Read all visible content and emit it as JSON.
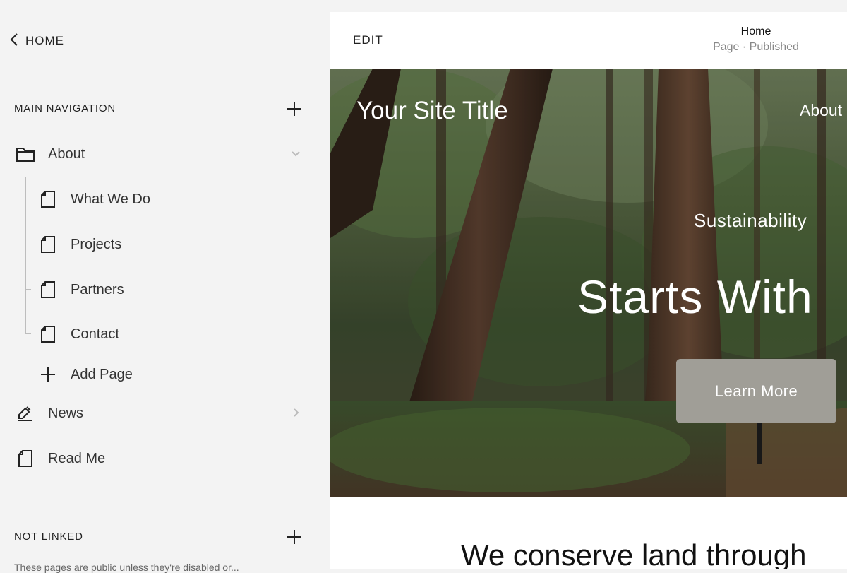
{
  "sidebar": {
    "back_label": "HOME",
    "main_nav_title": "MAIN NAVIGATION",
    "items": [
      {
        "label": "About",
        "icon": "folder-icon"
      },
      {
        "label": "What We Do",
        "icon": "page-icon"
      },
      {
        "label": "Projects",
        "icon": "page-icon"
      },
      {
        "label": "Partners",
        "icon": "page-icon"
      },
      {
        "label": "Contact",
        "icon": "page-icon"
      },
      {
        "label": "Add Page",
        "icon": "plus-icon"
      },
      {
        "label": "News",
        "icon": "blog-icon"
      },
      {
        "label": "Read Me",
        "icon": "page-icon"
      }
    ],
    "not_linked_title": "NOT LINKED",
    "not_linked_desc": "These pages are public unless they're disabled or..."
  },
  "preview": {
    "edit_label": "EDIT",
    "page_name": "Home",
    "page_status": "Page · Published",
    "hero": {
      "site_title": "Your Site Title",
      "nav_about": "About",
      "kicker": "Sustainability",
      "headline": "Starts With",
      "cta": "Learn More"
    },
    "intro_text": "We conserve land through"
  }
}
